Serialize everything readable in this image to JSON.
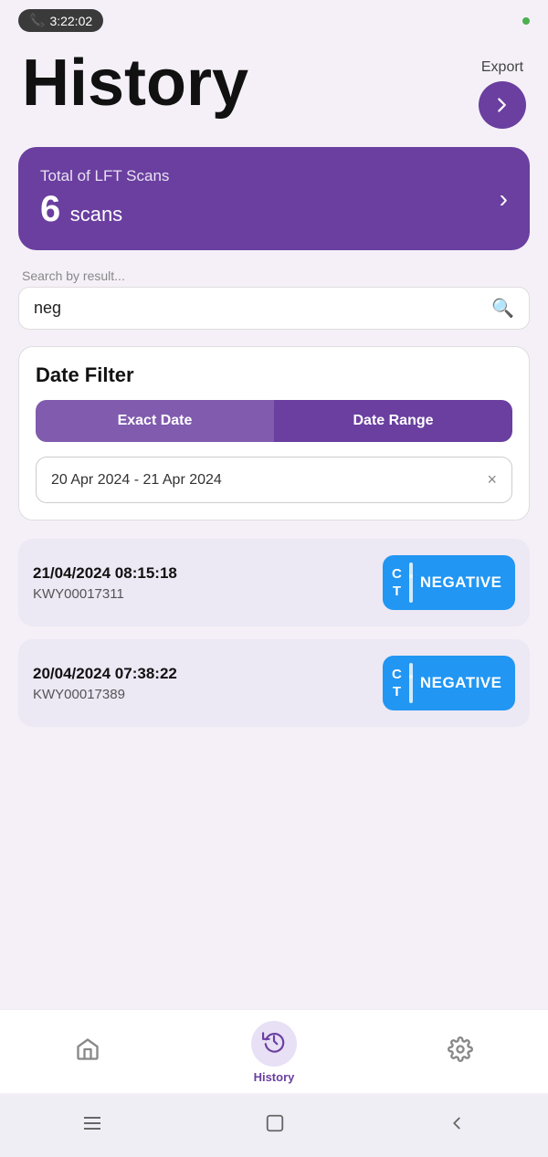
{
  "statusBar": {
    "time": "3:22:02",
    "phoneIcon": "📞"
  },
  "header": {
    "title": "History",
    "exportLabel": "Export"
  },
  "statsCard": {
    "label": "Total of LFT Scans",
    "count": "6",
    "unit": "scans"
  },
  "search": {
    "placeholder": "Search by result...",
    "value": "neg",
    "iconLabel": "🔍"
  },
  "dateFilter": {
    "title": "Date Filter",
    "tab1": "Exact Date",
    "tab2": "Date Range",
    "dateRangeValue": "20 Apr 2024 - 21 Apr 2024",
    "clearLabel": "×"
  },
  "results": [
    {
      "datetime": "21/04/2024 08:15:18",
      "id": "KWY00017311",
      "ctTop": "C",
      "ctBottom": "T",
      "result": "NEGATIVE"
    },
    {
      "datetime": "20/04/2024 07:38:22",
      "id": "KWY00017389",
      "ctTop": "C",
      "ctBottom": "T",
      "result": "NEGATIVE"
    }
  ],
  "nav": {
    "homeLabel": "🏠",
    "historyLabel": "History",
    "settingsLabel": "⚙️"
  },
  "systemBar": {
    "menuIcon": "|||",
    "homeIcon": "○",
    "backIcon": "<"
  }
}
